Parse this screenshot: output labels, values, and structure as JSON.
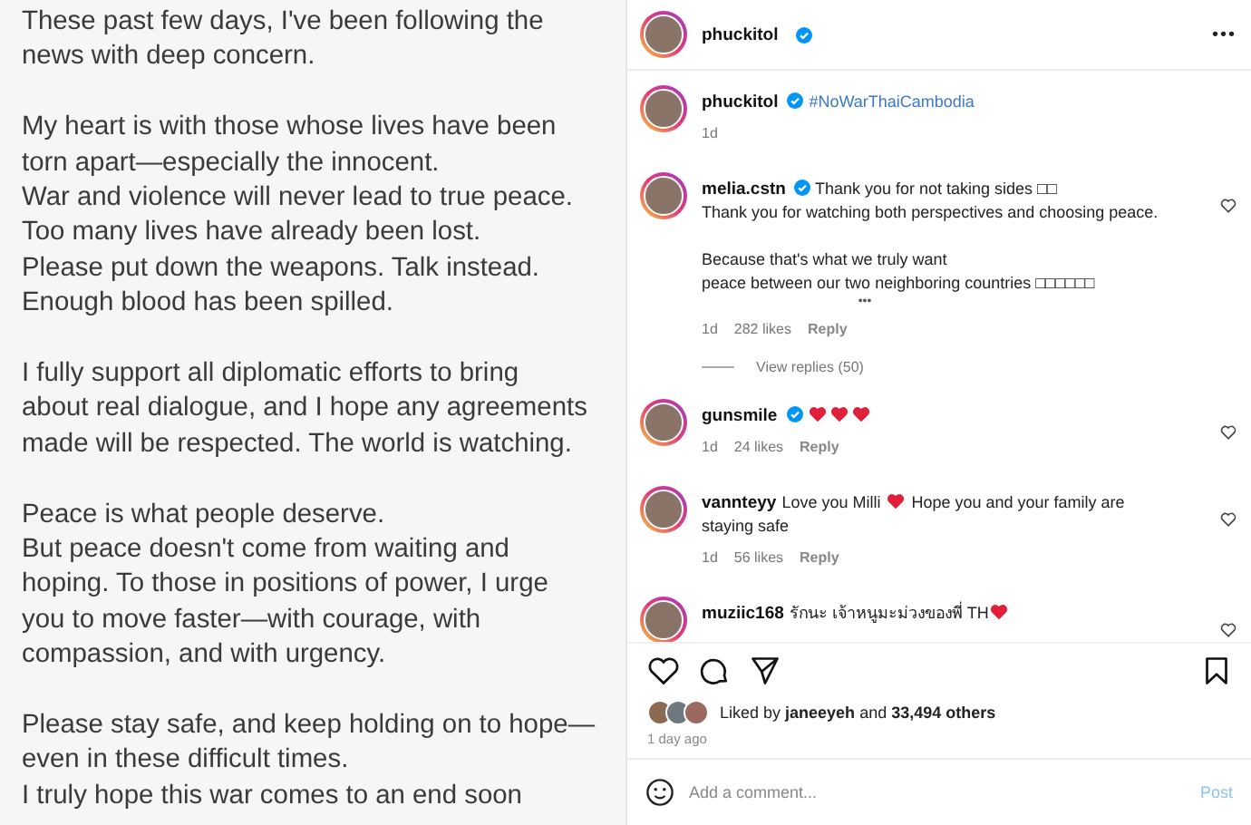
{
  "post_text": [
    "These past few days, I've been following the\nnews with deep concern.",
    "My heart is with those whose lives have been\ntorn apart—especially the innocent.\nWar and violence will never lead to true peace.\nToo many lives have already been lost.\nPlease put down the weapons. Talk instead.\nEnough blood has been spilled.",
    "I fully support all diplomatic efforts to bring\nabout real dialogue, and I hope any agreements\nmade will be respected. The world is watching.",
    "Peace is what people deserve.\nBut peace doesn't come from waiting and\nhoping. To those in positions of power, I urge\nyou to move faster—with courage, with\ncompassion, and with urgency.",
    "Please stay safe, and keep holding on to hope—\neven in these difficult times.\nI truly hope this war comes to an end soon"
  ],
  "header": {
    "username": "phuckitol",
    "verified": true,
    "more": "•••"
  },
  "comments": [
    {
      "kind": "caption",
      "username": "phuckitol",
      "verified": true,
      "parts": [
        {
          "kind": "hashtag",
          "text": "#NoWarThaiCambodia"
        }
      ],
      "time": "1d"
    },
    {
      "kind": "comment",
      "username": "melia.cstn",
      "verified": true,
      "parts": [
        {
          "kind": "text",
          "text": "Thank you for not taking sides □□"
        },
        {
          "kind": "paragraph",
          "text": "Thank you for watching both perspectives and choosing peace.\n\nBecause that's what we truly want\npeace between our two neighboring countries □□□□□□"
        }
      ],
      "more": "•••",
      "time": "1d",
      "likes": "282 likes",
      "reply": "Reply",
      "view_replies": "View replies (50)"
    },
    {
      "kind": "comment",
      "username": "gunsmile",
      "verified": true,
      "parts": [
        {
          "kind": "heart"
        },
        {
          "kind": "heart"
        },
        {
          "kind": "heart"
        }
      ],
      "time": "1d",
      "likes": "24 likes",
      "reply": "Reply"
    },
    {
      "kind": "comment",
      "username": "vannteyy",
      "verified": false,
      "parts": [
        {
          "kind": "text",
          "text": "Love you Milli "
        },
        {
          "kind": "heart"
        },
        {
          "kind": "text",
          "text": " Hope you and your family are"
        },
        {
          "kind": "paragraph",
          "text": "staying safe"
        }
      ],
      "time": "1d",
      "likes": "56 likes",
      "reply": "Reply"
    },
    {
      "kind": "comment",
      "username": "muziic168",
      "verified": false,
      "parts": [
        {
          "kind": "text",
          "text": "รักนะ เจ้าหนูมะม่วงของพี่ TH"
        },
        {
          "kind": "heart"
        }
      ]
    }
  ],
  "likes_line": "Liked by **janeeyeh** and **33,494 others**",
  "posted": "1 day ago",
  "comment_field": {
    "placeholder": "Add a comment...",
    "post": "Post"
  }
}
